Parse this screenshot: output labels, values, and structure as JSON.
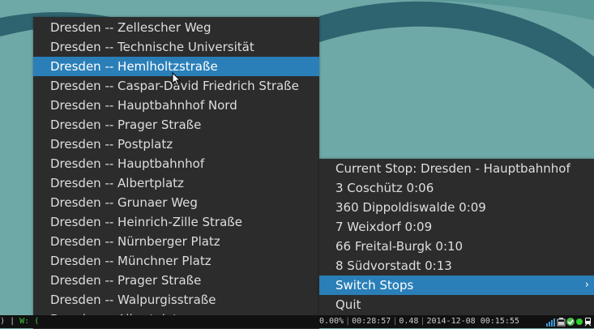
{
  "stops_menu": {
    "items": [
      {
        "label": "Dresden -- Zellescher Weg",
        "active": false
      },
      {
        "label": "Dresden -- Technische Universität",
        "active": false
      },
      {
        "label": "Dresden -- Hemlholtzstraße",
        "active": true
      },
      {
        "label": "Dresden -- Caspar-David Friedrich Straße",
        "active": false
      },
      {
        "label": "Dresden -- Hauptbahnhof Nord",
        "active": false
      },
      {
        "label": "Dresden -- Prager Straße",
        "active": false
      },
      {
        "label": "Dresden -- Postplatz",
        "active": false
      },
      {
        "label": "Dresden -- Hauptbahnhof",
        "active": false
      },
      {
        "label": "Dresden -- Albertplatz",
        "active": false
      },
      {
        "label": "Dresden -- Grunaer Weg",
        "active": false
      },
      {
        "label": "Dresden -- Heinrich-Zille Straße",
        "active": false
      },
      {
        "label": "Dresden -- Nürnberger Platz",
        "active": false
      },
      {
        "label": "Dresden -- Münchner Platz",
        "active": false
      },
      {
        "label": "Dresden -- Prager Straße",
        "active": false
      },
      {
        "label": "Dresden -- Walpurgisstraße",
        "active": false
      },
      {
        "label": "Dresden -- Albertplatz",
        "active": false
      }
    ]
  },
  "info_menu": {
    "current_stop": "Current Stop: Dresden - Hauptbahnhof",
    "departures": [
      "3 Coschütz 0:06",
      "360 Dippoldiswalde 0:09",
      "7 Weixdorf 0:09",
      "66 Freital-Burgk 0:10",
      "8 Südvorstadt 0:13"
    ],
    "switch_stops": "Switch Stops",
    "switch_arrow": "›",
    "quit": "Quit"
  },
  "statusbar": {
    "left_paren": ")",
    "left_sep": "|",
    "workspace": "W:",
    "left_tail": "(",
    "percent": "0.00%",
    "uptime": "00:28:57",
    "load": "0.48",
    "date": "2014-12-08",
    "time": "00:15:55"
  },
  "colors": {
    "wallpaper": "#6fa9a7",
    "wallpaper_swoosh": "#2e6470",
    "menu_bg": "#2c2c2c",
    "highlight": "#2a7fb8",
    "statusbar_bg": "#111111"
  },
  "tray_icons": [
    "signal-icon",
    "battery-icon",
    "check-icon",
    "status-dot-icon",
    "train-icon"
  ]
}
